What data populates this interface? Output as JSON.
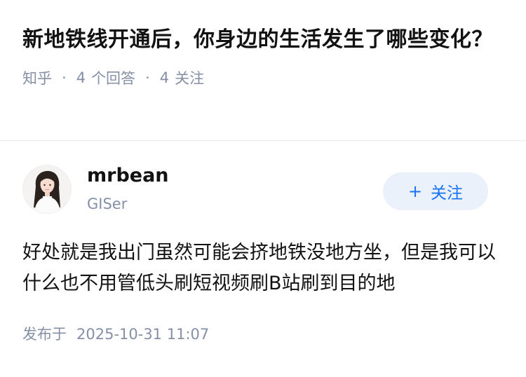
{
  "question": {
    "title": "新地铁线开通后，你身边的生活发生了哪些变化？",
    "source": "知乎",
    "separator": "·",
    "answer_count": "4",
    "answer_label": "个回答",
    "follow_count": "4",
    "follow_label": "关注"
  },
  "answer": {
    "author": {
      "name": "mrbean",
      "bio": "GISer",
      "avatar_icon": "avatar-girl-photo"
    },
    "follow_button": {
      "plus": "+",
      "label": "关注"
    },
    "content": "好处就是我出门虽然可能会挤地铁没地方坐，但是我可以什么也不用管低头刷短视频刷B站刷到目的地",
    "published_label": "发布于",
    "published_time": "2025-10-31 11:07"
  },
  "colors": {
    "text_primary": "#121212",
    "text_secondary": "#8590a6",
    "accent": "#1772f6",
    "accent_bg": "#eaf1fa",
    "divider": "#ebebeb"
  }
}
